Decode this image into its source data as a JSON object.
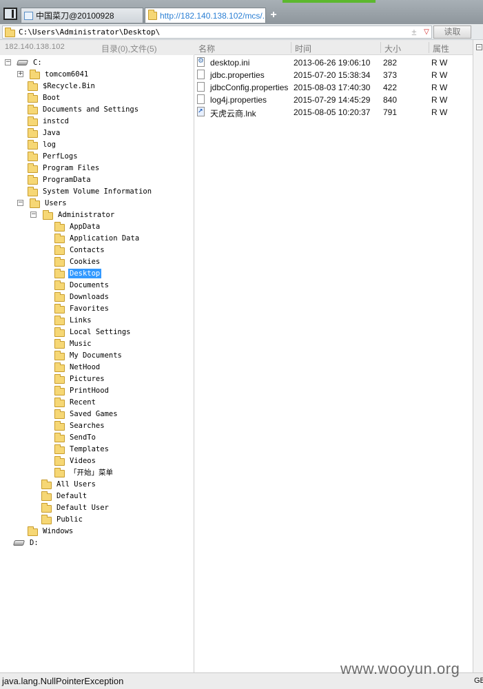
{
  "tabs": [
    {
      "label": "中国菜刀@20100928",
      "active": false
    },
    {
      "label": "http://182.140.138.102/mcs/...",
      "active": true
    }
  ],
  "new_tab_label": "+",
  "address": {
    "path": "C:\\Users\\Administrator\\Desktop\\",
    "read_label": "读取",
    "plus": "±",
    "dropdown": "▽"
  },
  "left_header": {
    "ip": "182.140.138.102",
    "counts": "目录(0),文件(5)"
  },
  "columns": {
    "name": "名称",
    "time": "时间",
    "size": "大小",
    "attr": "属性"
  },
  "tree": [
    {
      "label": "C:",
      "type": "drive",
      "expander": "⊟"
    },
    {
      "label": "tomcom6041",
      "type": "folder",
      "expander": "⊞"
    },
    {
      "label": "$Recycle.Bin",
      "type": "folder"
    },
    {
      "label": "Boot",
      "type": "folder"
    },
    {
      "label": "Documents and Settings",
      "type": "folder"
    },
    {
      "label": "instcd",
      "type": "folder"
    },
    {
      "label": "Java",
      "type": "folder"
    },
    {
      "label": "log",
      "type": "folder"
    },
    {
      "label": "PerfLogs",
      "type": "folder"
    },
    {
      "label": "Program Files",
      "type": "folder"
    },
    {
      "label": "ProgramData",
      "type": "folder"
    },
    {
      "label": "System Volume Information",
      "type": "folder"
    },
    {
      "label": "Users",
      "type": "folder",
      "expander": "⊟"
    },
    {
      "label": "Administrator",
      "type": "folder",
      "expander": "⊟"
    },
    {
      "label": "AppData",
      "type": "folder"
    },
    {
      "label": "Application Data",
      "type": "folder"
    },
    {
      "label": "Contacts",
      "type": "folder"
    },
    {
      "label": "Cookies",
      "type": "folder"
    },
    {
      "label": "Desktop",
      "type": "folder",
      "selected": true
    },
    {
      "label": "Documents",
      "type": "folder"
    },
    {
      "label": "Downloads",
      "type": "folder"
    },
    {
      "label": "Favorites",
      "type": "folder"
    },
    {
      "label": "Links",
      "type": "folder"
    },
    {
      "label": "Local Settings",
      "type": "folder"
    },
    {
      "label": "Music",
      "type": "folder"
    },
    {
      "label": "My Documents",
      "type": "folder"
    },
    {
      "label": "NetHood",
      "type": "folder"
    },
    {
      "label": "Pictures",
      "type": "folder"
    },
    {
      "label": "PrintHood",
      "type": "folder"
    },
    {
      "label": "Recent",
      "type": "folder"
    },
    {
      "label": "Saved Games",
      "type": "folder"
    },
    {
      "label": "Searches",
      "type": "folder"
    },
    {
      "label": "SendTo",
      "type": "folder"
    },
    {
      "label": "Templates",
      "type": "folder"
    },
    {
      "label": "Videos",
      "type": "folder"
    },
    {
      "label": "「开始」菜单",
      "type": "folder"
    },
    {
      "label": "All Users",
      "type": "folder"
    },
    {
      "label": "Default",
      "type": "folder"
    },
    {
      "label": "Default User",
      "type": "folder"
    },
    {
      "label": "Public",
      "type": "folder"
    },
    {
      "label": "Windows",
      "type": "folder"
    },
    {
      "label": "D:",
      "type": "drive"
    }
  ],
  "files": [
    {
      "name": "desktop.ini",
      "time": "2013-06-26 19:06:10",
      "size": "282",
      "attr": "R W",
      "icon": "settings-file-icon"
    },
    {
      "name": "jdbc.properties",
      "time": "2015-07-20 15:38:34",
      "size": "373",
      "attr": "R W",
      "icon": "file-icon"
    },
    {
      "name": "jdbcConfig.properties",
      "time": "2015-08-03 17:40:30",
      "size": "422",
      "attr": "R W",
      "icon": "file-icon"
    },
    {
      "name": "log4j.properties",
      "time": "2015-07-29 14:45:29",
      "size": "840",
      "attr": "R W",
      "icon": "file-icon"
    },
    {
      "name": "天虎云商.lnk",
      "time": "2015-08-05 10:20:37",
      "size": "791",
      "attr": "R W",
      "icon": "shortcut-icon"
    }
  ],
  "status": {
    "message": "java.lang.NullPointerException",
    "encoding": "GB"
  },
  "watermark": "www.wooyun.org",
  "colors": {
    "selection": "#3399ff",
    "active_tab_text": "#2a7fd4",
    "folder": "#f6d775",
    "accent_green": "#5cb82e"
  }
}
